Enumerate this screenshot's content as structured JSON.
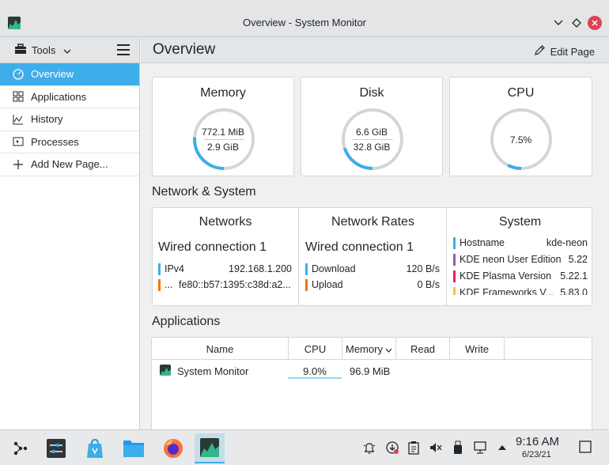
{
  "window": {
    "title": "Overview - System Monitor"
  },
  "sidebar": {
    "tools_label": "Tools",
    "items": [
      {
        "label": "Overview",
        "icon": "gauge-icon"
      },
      {
        "label": "Applications",
        "icon": "grid-icon"
      },
      {
        "label": "History",
        "icon": "chart-icon"
      },
      {
        "label": "Processes",
        "icon": "terminal-icon"
      },
      {
        "label": "Add New Page...",
        "icon": "plus-icon"
      }
    ]
  },
  "header": {
    "title": "Overview",
    "edit_label": "Edit Page"
  },
  "cards": {
    "memory": {
      "title": "Memory",
      "used": "772.1 MiB",
      "total": "2.9 GiB",
      "fraction": 0.26
    },
    "disk": {
      "title": "Disk",
      "used": "6.6 GiB",
      "total": "32.8 GiB",
      "fraction": 0.2
    },
    "cpu": {
      "title": "CPU",
      "value": "7.5%",
      "fraction": 0.075
    }
  },
  "network_system": {
    "section_title": "Network & System",
    "networks": {
      "title": "Networks",
      "connection": "Wired connection 1",
      "rows": [
        {
          "key": "IPv4",
          "value": "192.168.1.200",
          "color": "#3daee9"
        },
        {
          "key": "...",
          "value": "fe80::b57:1395:c38d:a2...",
          "color": "#f67400"
        }
      ]
    },
    "rates": {
      "title": "Network Rates",
      "connection": "Wired connection 1",
      "rows": [
        {
          "key": "Download",
          "value": "120 B/s",
          "color": "#3daee9"
        },
        {
          "key": "Upload",
          "value": "0 B/s",
          "color": "#f67400"
        }
      ]
    },
    "system": {
      "title": "System",
      "rows": [
        {
          "key": "Hostname",
          "value": "kde-neon",
          "color": "#3daee9"
        },
        {
          "key": "KDE neon User Edition",
          "value": "5.22",
          "color": "#9b59b6"
        },
        {
          "key": "KDE Plasma Version",
          "value": "5.22.1",
          "color": "#e91e63"
        },
        {
          "key": "KDE Frameworks V...",
          "value": "5.83.0",
          "color": "#fdbc4b"
        }
      ]
    }
  },
  "applications": {
    "section_title": "Applications",
    "columns": [
      "Name",
      "CPU",
      "Memory",
      "Read",
      "Write"
    ],
    "rows": [
      {
        "name": "System Monitor",
        "cpu": "9.0%",
        "memory": "96.9 MiB",
        "read": "",
        "write": ""
      }
    ]
  },
  "taskbar": {
    "apps": [
      "launcher-icon",
      "settings-icon",
      "discover-icon",
      "files-icon",
      "firefox-icon",
      "system-monitor-icon"
    ],
    "tray": [
      "notifications-icon",
      "updates-icon",
      "clipboard-icon",
      "volume-muted-icon",
      "usb-icon",
      "network-icon",
      "expand-tray-icon"
    ],
    "time": "9:16 AM",
    "date": "6/23/21"
  },
  "colors": {
    "accent": "#3daee9",
    "track": "#d3d6d9"
  }
}
